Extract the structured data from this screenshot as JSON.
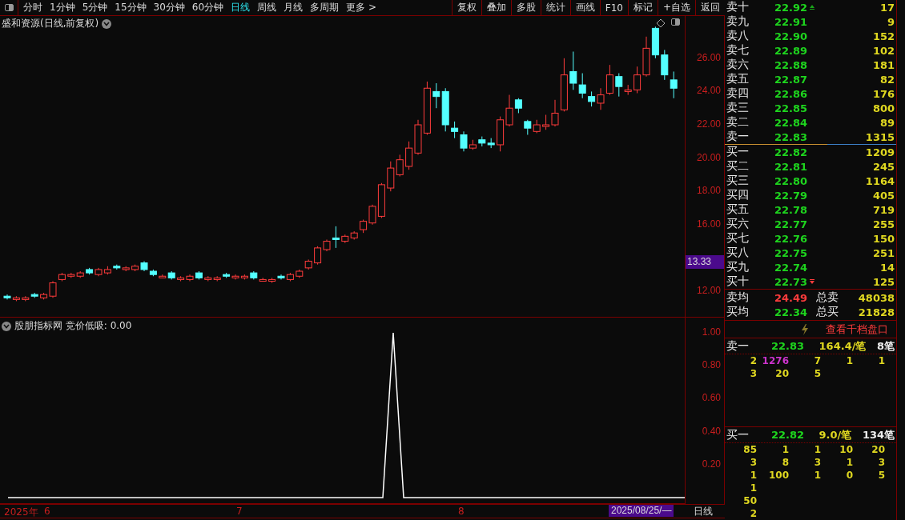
{
  "toolbar": {
    "periods": [
      {
        "label": "分时",
        "selected": false
      },
      {
        "label": "1分钟",
        "selected": false
      },
      {
        "label": "5分钟",
        "selected": false
      },
      {
        "label": "15分钟",
        "selected": false
      },
      {
        "label": "30分钟",
        "selected": false
      },
      {
        "label": "60分钟",
        "selected": false
      },
      {
        "label": "日线",
        "selected": true
      },
      {
        "label": "周线",
        "selected": false
      },
      {
        "label": "月线",
        "selected": false
      },
      {
        "label": "多周期",
        "selected": false
      },
      {
        "label": "更多 >",
        "selected": false
      }
    ],
    "buttons": [
      "复权",
      "叠加",
      "多股",
      "统计",
      "画线",
      "F10",
      "标记",
      "+自选",
      "返回"
    ]
  },
  "main_chart": {
    "title": "盛和资源(日线,前复权)",
    "price_tag": "13.33",
    "chart_data": {
      "type": "candlestick",
      "ylim": [
        10.46,
        28.54
      ],
      "yticks": [
        {
          "value": 26,
          "label": "26.00"
        },
        {
          "value": 24,
          "label": "24.00"
        },
        {
          "value": 22,
          "label": "22.00"
        },
        {
          "value": 20,
          "label": "20.00"
        },
        {
          "value": 18,
          "label": "18.00"
        },
        {
          "value": 16,
          "label": "16.00"
        },
        {
          "value": 12,
          "label": "12.00"
        }
      ],
      "ohlc": [
        [
          11.7,
          11.8,
          11.5,
          11.6
        ],
        [
          11.5,
          11.7,
          11.4,
          11.6
        ],
        [
          11.5,
          11.7,
          11.4,
          11.6
        ],
        [
          11.8,
          11.9,
          11.6,
          11.7
        ],
        [
          11.6,
          11.9,
          11.5,
          11.8
        ],
        [
          11.7,
          12.6,
          11.6,
          12.5
        ],
        [
          12.7,
          13.1,
          12.6,
          13.0
        ],
        [
          12.9,
          13.1,
          12.8,
          13.0
        ],
        [
          12.9,
          13.2,
          12.8,
          13.1
        ],
        [
          13.3,
          13.4,
          13.0,
          13.1
        ],
        [
          13.0,
          13.4,
          12.9,
          13.3
        ],
        [
          13.1,
          13.5,
          13.0,
          13.3
        ],
        [
          13.5,
          13.6,
          13.3,
          13.4
        ],
        [
          13.3,
          13.5,
          13.2,
          13.4
        ],
        [
          13.3,
          13.6,
          13.2,
          13.5
        ],
        [
          13.7,
          13.8,
          13.2,
          13.3
        ],
        [
          13.2,
          13.3,
          12.9,
          13.0
        ],
        [
          12.8,
          13.0,
          12.8,
          12.9
        ],
        [
          13.1,
          13.2,
          12.7,
          12.8
        ],
        [
          12.7,
          12.9,
          12.6,
          12.8
        ],
        [
          12.7,
          13.0,
          12.6,
          12.9
        ],
        [
          13.1,
          13.2,
          12.7,
          12.8
        ],
        [
          12.7,
          12.9,
          12.6,
          12.8
        ],
        [
          12.7,
          12.9,
          12.6,
          12.8
        ],
        [
          13.0,
          13.1,
          12.8,
          12.9
        ],
        [
          12.8,
          13.0,
          12.7,
          12.9
        ],
        [
          12.8,
          13.0,
          12.7,
          12.9
        ],
        [
          13.1,
          13.2,
          12.7,
          12.8
        ],
        [
          12.6,
          12.8,
          12.6,
          12.7
        ],
        [
          12.6,
          12.8,
          12.5,
          12.7
        ],
        [
          12.9,
          13.0,
          12.7,
          12.8
        ],
        [
          12.7,
          13.1,
          12.6,
          13.0
        ],
        [
          12.9,
          13.3,
          12.8,
          13.2
        ],
        [
          13.4,
          13.9,
          13.3,
          13.8
        ],
        [
          13.7,
          14.7,
          13.6,
          14.6
        ],
        [
          14.5,
          15.1,
          14.4,
          15.0
        ],
        [
          15.2,
          15.9,
          14.6,
          15.1
        ],
        [
          15.0,
          15.4,
          14.9,
          15.3
        ],
        [
          15.2,
          15.6,
          15.1,
          15.5
        ],
        [
          15.7,
          16.3,
          15.5,
          16.2
        ],
        [
          16.1,
          17.2,
          16.0,
          17.1
        ],
        [
          16.5,
          18.5,
          16.4,
          18.4
        ],
        [
          18.2,
          19.8,
          18.0,
          19.4
        ],
        [
          19.0,
          20.2,
          18.9,
          19.9
        ],
        [
          19.5,
          21.0,
          19.3,
          20.6
        ],
        [
          20.3,
          22.3,
          20.2,
          22.0
        ],
        [
          21.5,
          24.6,
          21.4,
          24.2
        ],
        [
          24.0,
          24.5,
          23.0,
          23.7
        ],
        [
          24.0,
          24.2,
          21.6,
          22.0
        ],
        [
          21.8,
          22.2,
          21.2,
          21.6
        ],
        [
          21.4,
          21.6,
          20.4,
          20.6
        ],
        [
          20.6,
          21.1,
          20.5,
          20.8
        ],
        [
          21.1,
          21.3,
          20.7,
          20.9
        ],
        [
          20.9,
          21.2,
          20.6,
          20.8
        ],
        [
          20.8,
          22.5,
          20.4,
          22.3
        ],
        [
          22.0,
          23.8,
          21.9,
          23.0
        ],
        [
          23.5,
          23.6,
          22.7,
          23.0
        ],
        [
          22.2,
          22.3,
          21.4,
          21.8
        ],
        [
          21.6,
          22.3,
          21.5,
          22.0
        ],
        [
          21.9,
          22.6,
          21.7,
          22.0
        ],
        [
          22.0,
          23.5,
          21.9,
          22.7
        ],
        [
          22.9,
          26.0,
          22.8,
          25.0
        ],
        [
          25.2,
          26.4,
          24.1,
          24.5
        ],
        [
          24.4,
          25.1,
          23.6,
          23.9
        ],
        [
          23.7,
          24.0,
          23.1,
          23.4
        ],
        [
          23.3,
          24.2,
          22.9,
          23.8
        ],
        [
          23.9,
          25.6,
          23.8,
          25.0
        ],
        [
          24.9,
          25.1,
          23.7,
          24.3
        ],
        [
          24.0,
          24.4,
          23.8,
          24.1
        ],
        [
          24.1,
          25.5,
          23.9,
          25.0
        ],
        [
          25.0,
          27.3,
          24.9,
          26.6
        ],
        [
          27.8,
          27.9,
          26.0,
          26.2
        ],
        [
          26.2,
          26.5,
          24.7,
          25.0
        ],
        [
          24.7,
          25.2,
          23.6,
          24.2
        ]
      ]
    }
  },
  "indicator": {
    "title": "股朋指标网 竞价低吸: 0.00",
    "chart_data": {
      "type": "line",
      "ylim": [
        -0.034,
        1.092
      ],
      "yticks": [
        {
          "value": 0.2,
          "label": "0.20"
        },
        {
          "value": 0.4,
          "label": "0.40"
        },
        {
          "value": 0.6,
          "label": "0.60"
        },
        {
          "value": 0.8,
          "label": "0.80"
        },
        {
          "value": 1.0,
          "label": "1.00"
        }
      ],
      "series": [
        {
          "color": "#ffffff",
          "values": [
            0,
            0,
            0,
            0,
            0,
            0,
            0,
            0,
            0,
            0,
            0,
            0,
            0,
            0,
            0,
            0,
            0,
            0,
            0,
            0,
            0,
            0,
            0,
            0,
            0,
            0,
            0,
            0,
            0,
            0,
            0,
            0,
            0,
            0,
            0,
            0,
            0,
            1,
            0,
            0,
            0,
            0,
            0,
            0,
            0,
            0,
            0,
            0,
            0,
            0,
            0,
            0,
            0,
            0,
            0,
            0,
            0,
            0,
            0,
            0,
            0,
            0,
            0,
            0,
            0,
            0
          ]
        }
      ]
    }
  },
  "time_axis": {
    "year": "2025年",
    "months": [
      "6",
      "7",
      "8"
    ],
    "cursor_date": "2025/08/25/—",
    "period": "日线"
  },
  "order_book": {
    "asks": [
      {
        "label": "卖十",
        "price": "22.92",
        "volume": "17",
        "up_arrow": true
      },
      {
        "label": "卖九",
        "price": "22.91",
        "volume": "9"
      },
      {
        "label": "卖八",
        "price": "22.90",
        "volume": "152"
      },
      {
        "label": "卖七",
        "price": "22.89",
        "volume": "102"
      },
      {
        "label": "卖六",
        "price": "22.88",
        "volume": "181"
      },
      {
        "label": "卖五",
        "price": "22.87",
        "volume": "82"
      },
      {
        "label": "卖四",
        "price": "22.86",
        "volume": "176"
      },
      {
        "label": "卖三",
        "price": "22.85",
        "volume": "800"
      },
      {
        "label": "卖二",
        "price": "22.84",
        "volume": "89"
      },
      {
        "label": "卖一",
        "price": "22.83",
        "volume": "1315"
      }
    ],
    "bids": [
      {
        "label": "买一",
        "price": "22.82",
        "volume": "1209"
      },
      {
        "label": "买二",
        "price": "22.81",
        "volume": "245"
      },
      {
        "label": "买三",
        "price": "22.80",
        "volume": "1164"
      },
      {
        "label": "买四",
        "price": "22.79",
        "volume": "405"
      },
      {
        "label": "买五",
        "price": "22.78",
        "volume": "719"
      },
      {
        "label": "买六",
        "price": "22.77",
        "volume": "255"
      },
      {
        "label": "买七",
        "price": "22.76",
        "volume": "150"
      },
      {
        "label": "买八",
        "price": "22.75",
        "volume": "251"
      },
      {
        "label": "买九",
        "price": "22.74",
        "volume": "14"
      },
      {
        "label": "买十",
        "price": "22.73",
        "volume": "125",
        "down_arrow": true
      }
    ],
    "summary": [
      {
        "label": "卖均",
        "price": "24.49",
        "rising": true,
        "total_label": "总卖",
        "total": "48038"
      },
      {
        "label": "买均",
        "price": "22.34",
        "rising": false,
        "total_label": "总买",
        "total": "21828"
      }
    ],
    "depth_link": "查看千档盘口",
    "queues": [
      {
        "label": "卖一",
        "price": "22.83",
        "average": "164.4/笔",
        "count": "8笔",
        "rows": [
          [
            {
              "text": "2"
            },
            {
              "text": "1276",
              "color": "#cc33cc"
            },
            {
              "text": "7"
            },
            {
              "text": "1"
            },
            {
              "text": "1"
            }
          ],
          [
            {
              "text": "3"
            },
            {
              "text": "20"
            },
            {
              "text": "5"
            }
          ]
        ]
      },
      {
        "label": "买一",
        "price": "22.82",
        "average": "9.0/笔",
        "count": "134笔",
        "rows": [
          [
            {
              "text": "85"
            },
            {
              "text": "1"
            },
            {
              "text": "1"
            },
            {
              "text": "10"
            },
            {
              "text": "20"
            }
          ],
          [
            {
              "text": "3"
            },
            {
              "text": "8"
            },
            {
              "text": "3"
            },
            {
              "text": "1"
            },
            {
              "text": "3"
            }
          ],
          [
            {
              "text": "1"
            },
            {
              "text": "100"
            },
            {
              "text": "1"
            },
            {
              "text": "0"
            },
            {
              "text": "5"
            }
          ],
          [
            {
              "text": "1"
            }
          ],
          [
            {
              "text": "50"
            }
          ],
          [
            {
              "text": "2"
            }
          ]
        ]
      }
    ]
  }
}
